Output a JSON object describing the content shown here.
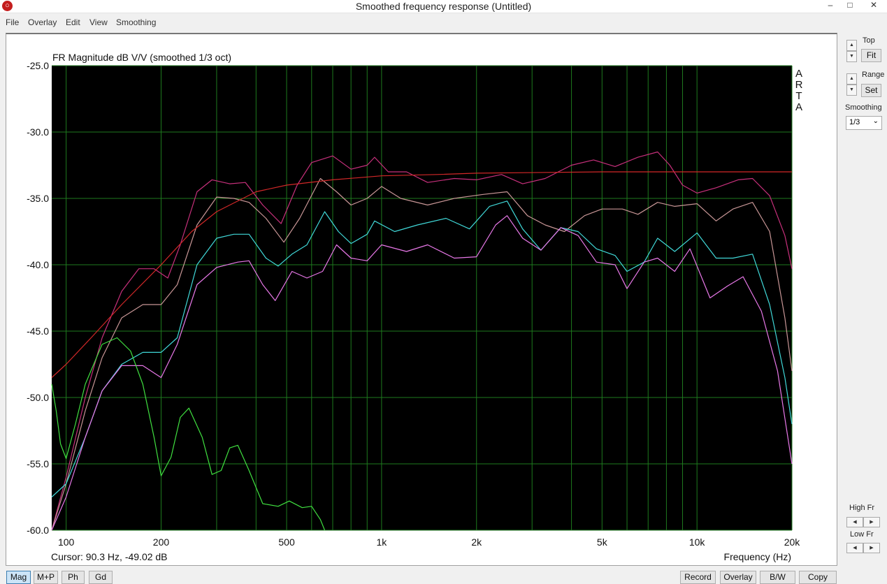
{
  "window": {
    "title": "Smoothed frequency response (Untitled)",
    "app_icon": "arta-icon"
  },
  "menu": [
    "File",
    "Overlay",
    "Edit",
    "View",
    "Smoothing"
  ],
  "side": {
    "top_label": "Top",
    "fit_label": "Fit",
    "range_label": "Range",
    "set_label": "Set",
    "smoothing_label": "Smoothing",
    "smoothing_value": "1/3",
    "high_fr_label": "High Fr",
    "low_fr_label": "Low Fr"
  },
  "status": {
    "cursor": "Cursor: 90.3 Hz, -49.02 dB"
  },
  "bottom_buttons": {
    "left": [
      "Mag",
      "M+P",
      "Ph",
      "Gd"
    ],
    "active": "Mag",
    "right": [
      "Record",
      "Overlay",
      "B/W",
      "Copy"
    ]
  },
  "chart_data": {
    "type": "line",
    "title": "FR Magnitude dB V/V (smoothed 1/3 oct)",
    "xlabel": "Frequency (Hz)",
    "ylabel": "",
    "xscale": "log",
    "xlim": [
      90,
      20000
    ],
    "ylim": [
      -60,
      -25
    ],
    "x_ticks": [
      100,
      200,
      500,
      1000,
      2000,
      5000,
      10000,
      20000
    ],
    "x_tick_labels": [
      "100",
      "200",
      "500",
      "1k",
      "2k",
      "5k",
      "10k",
      "20k"
    ],
    "y_ticks": [
      -25,
      -30,
      -35,
      -40,
      -45,
      -50,
      -55,
      -60
    ],
    "y_tick_labels": [
      "-25.0",
      "-30.0",
      "-35.0",
      "-40.0",
      "-45.0",
      "-50.0",
      "-55.0",
      "-60.0"
    ],
    "watermark": [
      "A",
      "R",
      "T",
      "A"
    ],
    "grid": true,
    "background": "#000000",
    "grid_color": "#1e7a1e",
    "series": [
      {
        "color": "#c8307c",
        "points": [
          [
            90,
            -60
          ],
          [
            100,
            -56
          ],
          [
            115,
            -50
          ],
          [
            130,
            -45.5
          ],
          [
            150,
            -42
          ],
          [
            170,
            -40.3
          ],
          [
            190,
            -40.3
          ],
          [
            210,
            -41
          ],
          [
            230,
            -38.5
          ],
          [
            260,
            -34.5
          ],
          [
            290,
            -33.6
          ],
          [
            330,
            -33.9
          ],
          [
            370,
            -33.8
          ],
          [
            420,
            -35.5
          ],
          [
            480,
            -36.9
          ],
          [
            540,
            -34
          ],
          [
            600,
            -32.3
          ],
          [
            700,
            -31.8
          ],
          [
            800,
            -32.8
          ],
          [
            900,
            -32.5
          ],
          [
            950,
            -31.9
          ],
          [
            1050,
            -33
          ],
          [
            1200,
            -33
          ],
          [
            1400,
            -33.8
          ],
          [
            1700,
            -33.5
          ],
          [
            2000,
            -33.6
          ],
          [
            2400,
            -33.2
          ],
          [
            2800,
            -33.9
          ],
          [
            3300,
            -33.5
          ],
          [
            4000,
            -32.5
          ],
          [
            4700,
            -32.1
          ],
          [
            5500,
            -32.6
          ],
          [
            6500,
            -31.9
          ],
          [
            7500,
            -31.5
          ],
          [
            8200,
            -32.5
          ],
          [
            9000,
            -34
          ],
          [
            10000,
            -34.6
          ],
          [
            11500,
            -34.2
          ],
          [
            13500,
            -33.6
          ],
          [
            15000,
            -33.5
          ],
          [
            17000,
            -34.8
          ],
          [
            19000,
            -37.8
          ],
          [
            20000,
            -40.3
          ]
        ]
      },
      {
        "color": "#c89696",
        "points": [
          [
            90,
            -60
          ],
          [
            100,
            -56.5
          ],
          [
            115,
            -51
          ],
          [
            130,
            -47
          ],
          [
            150,
            -44
          ],
          [
            175,
            -43
          ],
          [
            200,
            -43
          ],
          [
            225,
            -41.5
          ],
          [
            260,
            -37
          ],
          [
            300,
            -34.9
          ],
          [
            340,
            -35
          ],
          [
            380,
            -35.3
          ],
          [
            430,
            -36.5
          ],
          [
            490,
            -38.3
          ],
          [
            550,
            -36.5
          ],
          [
            640,
            -33.5
          ],
          [
            720,
            -34.5
          ],
          [
            800,
            -35.5
          ],
          [
            900,
            -35
          ],
          [
            1000,
            -34.1
          ],
          [
            1150,
            -35
          ],
          [
            1400,
            -35.5
          ],
          [
            1700,
            -35
          ],
          [
            2100,
            -34.7
          ],
          [
            2500,
            -34.5
          ],
          [
            2900,
            -36.3
          ],
          [
            3300,
            -37
          ],
          [
            3800,
            -37.5
          ],
          [
            4400,
            -36.3
          ],
          [
            5000,
            -35.8
          ],
          [
            5800,
            -35.8
          ],
          [
            6500,
            -36.2
          ],
          [
            7500,
            -35.3
          ],
          [
            8500,
            -35.6
          ],
          [
            10000,
            -35.4
          ],
          [
            11500,
            -36.7
          ],
          [
            13000,
            -35.8
          ],
          [
            15000,
            -35.3
          ],
          [
            17000,
            -37.5
          ],
          [
            19000,
            -44
          ],
          [
            20000,
            -48
          ]
        ]
      },
      {
        "color": "#40d8d8",
        "points": [
          [
            90,
            -57.5
          ],
          [
            100,
            -56.5
          ],
          [
            115,
            -53
          ],
          [
            130,
            -49.5
          ],
          [
            150,
            -47.5
          ],
          [
            175,
            -46.6
          ],
          [
            200,
            -46.6
          ],
          [
            225,
            -45.5
          ],
          [
            260,
            -40
          ],
          [
            300,
            -38
          ],
          [
            340,
            -37.7
          ],
          [
            380,
            -37.7
          ],
          [
            430,
            -39.5
          ],
          [
            470,
            -40.1
          ],
          [
            520,
            -39.2
          ],
          [
            580,
            -38.5
          ],
          [
            660,
            -36
          ],
          [
            730,
            -37.5
          ],
          [
            800,
            -38.4
          ],
          [
            900,
            -37.7
          ],
          [
            950,
            -36.7
          ],
          [
            1100,
            -37.5
          ],
          [
            1300,
            -37
          ],
          [
            1600,
            -36.5
          ],
          [
            1900,
            -37.3
          ],
          [
            2200,
            -35.6
          ],
          [
            2500,
            -35.2
          ],
          [
            2800,
            -37.3
          ],
          [
            3200,
            -38.9
          ],
          [
            3700,
            -37.2
          ],
          [
            4200,
            -37.5
          ],
          [
            4800,
            -38.8
          ],
          [
            5500,
            -39.3
          ],
          [
            6000,
            -40.5
          ],
          [
            6800,
            -39.8
          ],
          [
            7500,
            -38
          ],
          [
            8500,
            -39
          ],
          [
            10000,
            -37.6
          ],
          [
            11500,
            -39.5
          ],
          [
            13000,
            -39.5
          ],
          [
            15000,
            -39.2
          ],
          [
            17000,
            -43
          ],
          [
            19000,
            -48.5
          ],
          [
            20000,
            -52
          ]
        ]
      },
      {
        "color": "#e878e8",
        "points": [
          [
            90,
            -60
          ],
          [
            100,
            -57.5
          ],
          [
            115,
            -53
          ],
          [
            130,
            -49.5
          ],
          [
            150,
            -47.6
          ],
          [
            175,
            -47.6
          ],
          [
            200,
            -48.5
          ],
          [
            225,
            -46
          ],
          [
            260,
            -41.5
          ],
          [
            300,
            -40.2
          ],
          [
            350,
            -39.8
          ],
          [
            380,
            -39.7
          ],
          [
            420,
            -41.5
          ],
          [
            460,
            -42.7
          ],
          [
            520,
            -40.5
          ],
          [
            580,
            -41
          ],
          [
            650,
            -40.5
          ],
          [
            720,
            -38.5
          ],
          [
            800,
            -39.5
          ],
          [
            900,
            -39.7
          ],
          [
            1000,
            -38.5
          ],
          [
            1200,
            -39
          ],
          [
            1400,
            -38.5
          ],
          [
            1700,
            -39.5
          ],
          [
            2000,
            -39.4
          ],
          [
            2300,
            -37
          ],
          [
            2500,
            -36.3
          ],
          [
            2800,
            -38
          ],
          [
            3200,
            -38.9
          ],
          [
            3700,
            -37.2
          ],
          [
            4200,
            -37.8
          ],
          [
            4800,
            -39.8
          ],
          [
            5500,
            -40
          ],
          [
            6000,
            -41.8
          ],
          [
            6800,
            -39.8
          ],
          [
            7500,
            -39.5
          ],
          [
            8500,
            -40.5
          ],
          [
            9500,
            -38.8
          ],
          [
            11000,
            -42.5
          ],
          [
            12500,
            -41.6
          ],
          [
            14000,
            -40.9
          ],
          [
            16000,
            -43.5
          ],
          [
            18000,
            -48
          ],
          [
            20000,
            -55
          ]
        ]
      },
      {
        "color": "#40e040",
        "points": [
          [
            90,
            -49
          ],
          [
            93,
            -51
          ],
          [
            96,
            -53.5
          ],
          [
            100,
            -54.6
          ],
          [
            107,
            -52
          ],
          [
            115,
            -49
          ],
          [
            130,
            -46
          ],
          [
            145,
            -45.5
          ],
          [
            160,
            -46.5
          ],
          [
            175,
            -49
          ],
          [
            190,
            -53
          ],
          [
            200,
            -55.9
          ],
          [
            215,
            -54.5
          ],
          [
            230,
            -51.5
          ],
          [
            245,
            -50.8
          ],
          [
            270,
            -53
          ],
          [
            290,
            -55.8
          ],
          [
            310,
            -55.5
          ],
          [
            330,
            -53.8
          ],
          [
            350,
            -53.6
          ],
          [
            380,
            -55.5
          ],
          [
            420,
            -58
          ],
          [
            470,
            -58.2
          ],
          [
            510,
            -57.8
          ],
          [
            560,
            -58.3
          ],
          [
            600,
            -58.2
          ],
          [
            640,
            -59.2
          ],
          [
            660,
            -60
          ]
        ]
      },
      {
        "color": "#d22828",
        "points": [
          [
            90,
            -48.5
          ],
          [
            100,
            -47.5
          ],
          [
            120,
            -45.5
          ],
          [
            150,
            -43
          ],
          [
            200,
            -40
          ],
          [
            250,
            -37.5
          ],
          [
            300,
            -36
          ],
          [
            400,
            -34.5
          ],
          [
            500,
            -34
          ],
          [
            700,
            -33.6
          ],
          [
            1000,
            -33.3
          ],
          [
            1500,
            -33.2
          ],
          [
            2000,
            -33.1
          ],
          [
            5000,
            -33
          ],
          [
            20000,
            -33
          ]
        ]
      }
    ]
  }
}
